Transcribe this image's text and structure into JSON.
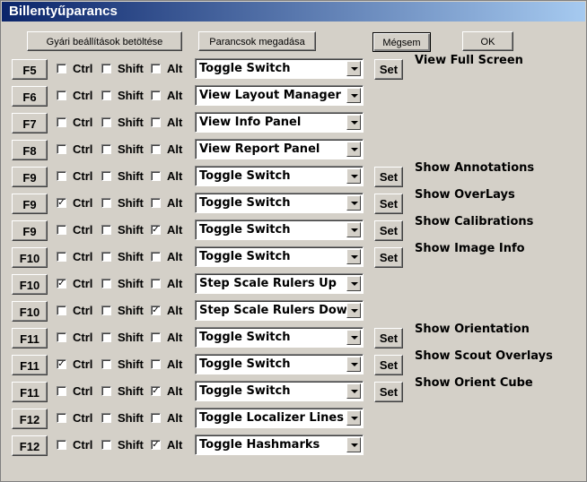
{
  "window": {
    "title": "Billentyűparancs"
  },
  "toolbar": {
    "load_defaults_label": "Gyári beállítások betöltése",
    "set_commands_label": "Parancsok megadása",
    "cancel_label": "Mégsem",
    "ok_label": "OK"
  },
  "labels": {
    "ctrl": "Ctrl",
    "shift": "Shift",
    "alt": "Alt",
    "set": "Set"
  },
  "rows": [
    {
      "key": "F5",
      "ctrl": false,
      "shift": false,
      "alt": false,
      "command": "Toggle Switch",
      "has_set": true,
      "description": "View Full Screen"
    },
    {
      "key": "F6",
      "ctrl": false,
      "shift": false,
      "alt": false,
      "command": "View Layout Manager",
      "has_set": false,
      "description": ""
    },
    {
      "key": "F7",
      "ctrl": false,
      "shift": false,
      "alt": false,
      "command": "View Info Panel",
      "has_set": false,
      "description": ""
    },
    {
      "key": "F8",
      "ctrl": false,
      "shift": false,
      "alt": false,
      "command": "View Report Panel",
      "has_set": false,
      "description": ""
    },
    {
      "key": "F9",
      "ctrl": false,
      "shift": false,
      "alt": false,
      "command": "Toggle Switch",
      "has_set": true,
      "description": "Show Annotations"
    },
    {
      "key": "F9",
      "ctrl": true,
      "shift": false,
      "alt": false,
      "command": "Toggle Switch",
      "has_set": true,
      "description": "Show OverLays"
    },
    {
      "key": "F9",
      "ctrl": false,
      "shift": false,
      "alt": true,
      "command": "Toggle Switch",
      "has_set": true,
      "description": "Show Calibrations"
    },
    {
      "key": "F10",
      "ctrl": false,
      "shift": false,
      "alt": false,
      "command": "Toggle Switch",
      "has_set": true,
      "description": "Show Image Info"
    },
    {
      "key": "F10",
      "ctrl": true,
      "shift": false,
      "alt": false,
      "command": "Step Scale Rulers Up",
      "has_set": false,
      "description": ""
    },
    {
      "key": "F10",
      "ctrl": false,
      "shift": false,
      "alt": true,
      "command": "Step Scale Rulers Down",
      "has_set": false,
      "description": ""
    },
    {
      "key": "F11",
      "ctrl": false,
      "shift": false,
      "alt": false,
      "command": "Toggle Switch",
      "has_set": true,
      "description": "Show Orientation"
    },
    {
      "key": "F11",
      "ctrl": true,
      "shift": false,
      "alt": false,
      "command": "Toggle Switch",
      "has_set": true,
      "description": "Show Scout Overlays"
    },
    {
      "key": "F11",
      "ctrl": false,
      "shift": false,
      "alt": true,
      "command": "Toggle Switch",
      "has_set": true,
      "description": "Show Orient Cube"
    },
    {
      "key": "F12",
      "ctrl": false,
      "shift": false,
      "alt": false,
      "command": "Toggle Localizer Lines",
      "has_set": false,
      "description": ""
    },
    {
      "key": "F12",
      "ctrl": false,
      "shift": false,
      "alt": true,
      "command": "Toggle Hashmarks",
      "has_set": false,
      "description": ""
    }
  ]
}
